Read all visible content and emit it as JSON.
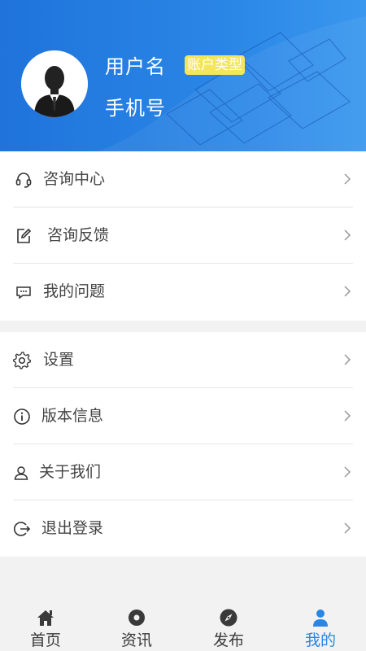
{
  "profile": {
    "username": "用户名",
    "account_type": "账户类型",
    "phone": "手机号"
  },
  "menu_group1": [
    {
      "label": "咨询中心",
      "icon": "headset-icon"
    },
    {
      "label": "咨询反馈",
      "icon": "edit-icon"
    },
    {
      "label": "我的问题",
      "icon": "chat-icon"
    }
  ],
  "menu_group2": [
    {
      "label": "设置",
      "icon": "gear-icon"
    },
    {
      "label": "版本信息",
      "icon": "info-icon"
    },
    {
      "label": "关于我们",
      "icon": "user-icon"
    },
    {
      "label": "退出登录",
      "icon": "logout-icon"
    }
  ],
  "tabs": [
    {
      "label": "首页",
      "icon": "home-icon"
    },
    {
      "label": "资讯",
      "icon": "news-icon"
    },
    {
      "label": "发布",
      "icon": "compass-icon"
    },
    {
      "label": "我的",
      "icon": "profile-icon",
      "active": true
    }
  ],
  "colors": {
    "header": "#2a86e6",
    "badge": "#f3e65a",
    "active_tab": "#2a86e6"
  }
}
